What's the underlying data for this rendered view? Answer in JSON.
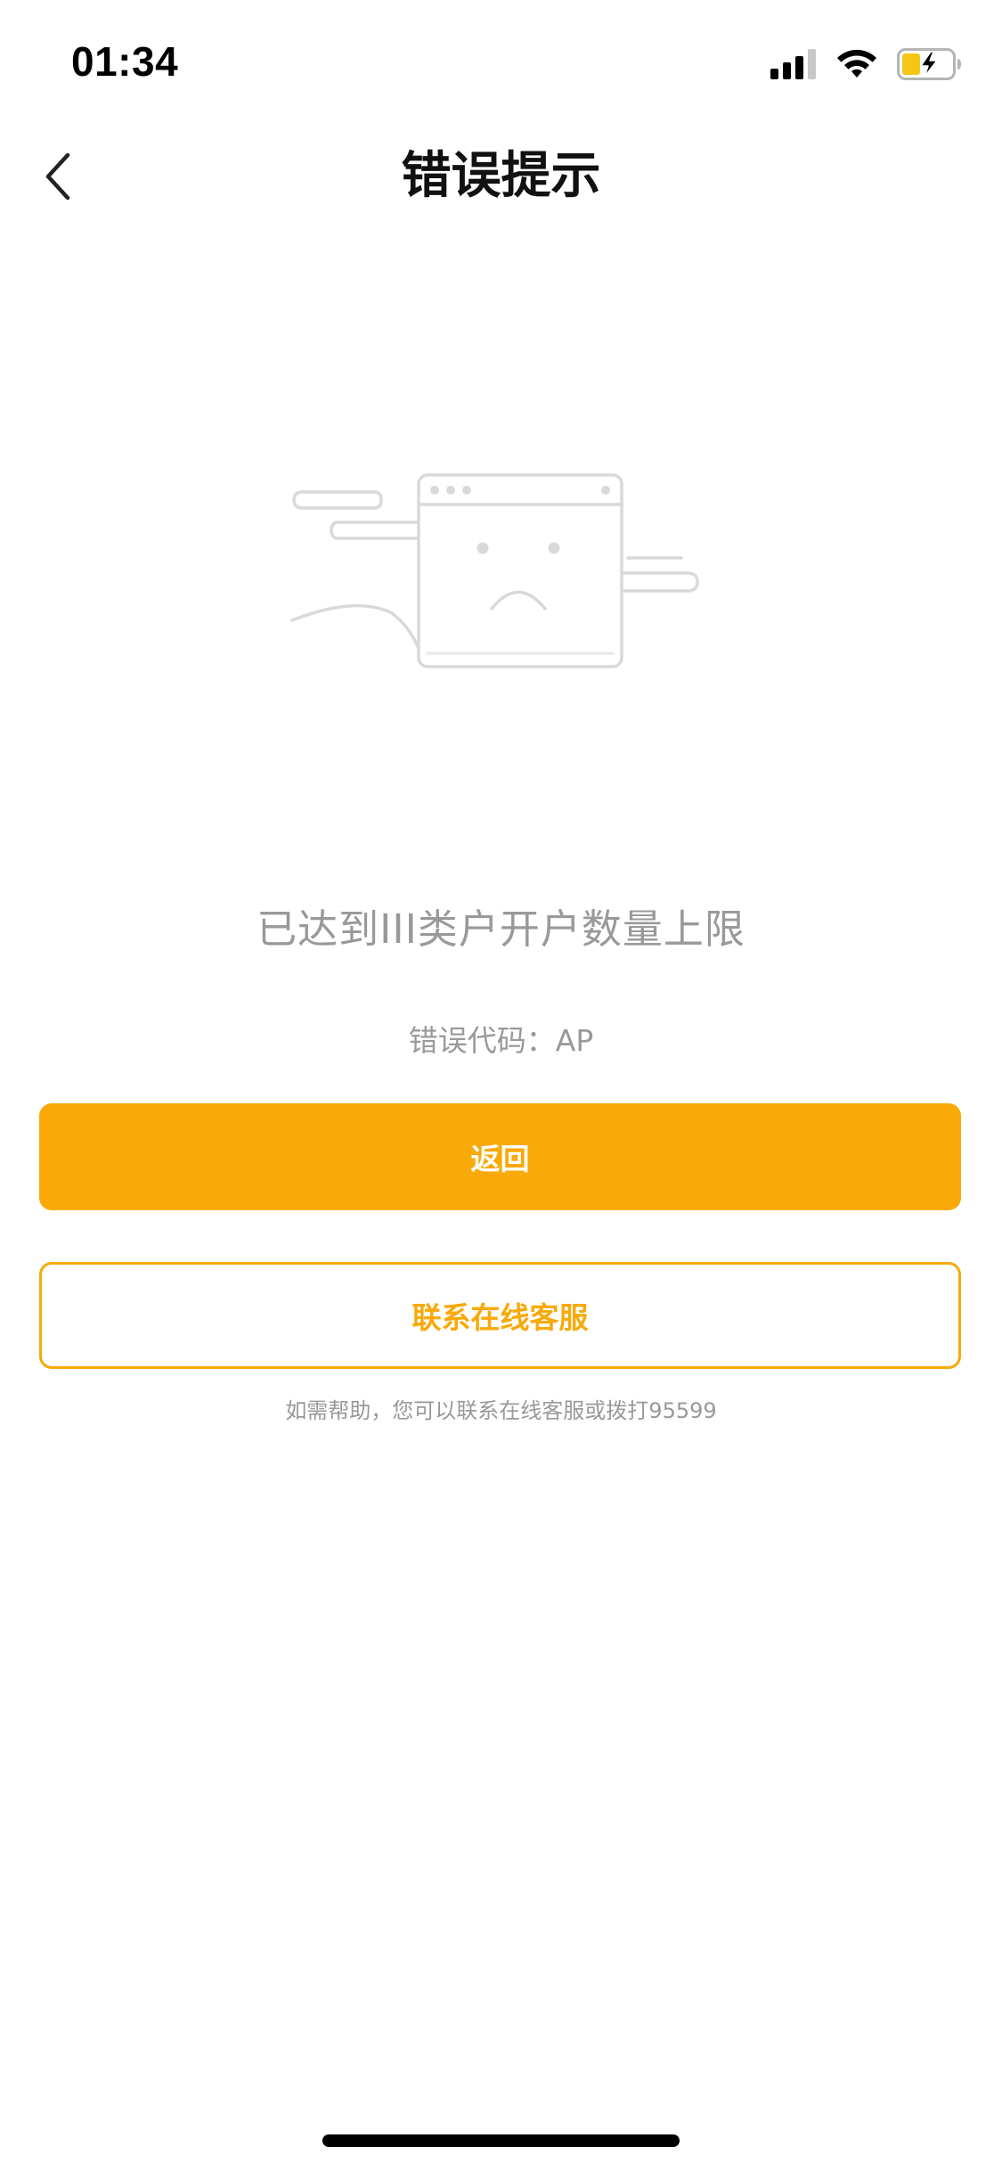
{
  "status_bar": {
    "time": "01:34",
    "icons": [
      "cellular-signal-icon",
      "wifi-icon",
      "battery-charging-icon"
    ],
    "battery_color": "#f5c518"
  },
  "nav": {
    "title": "错误提示",
    "back_icon": "chevron-left-icon"
  },
  "illustration": {
    "icon": "sad-browser-window-icon"
  },
  "content": {
    "message": "已达到III类户开户数量上限",
    "error_code": "错误代码：AP"
  },
  "actions": {
    "back_label": "返回",
    "contact_label": "联系在线客服"
  },
  "help": {
    "text": "如需帮助，您可以联系在线客服或拨打95599"
  },
  "colors": {
    "accent": "#f9a908",
    "muted_text": "#999999",
    "title_text": "#111111"
  }
}
